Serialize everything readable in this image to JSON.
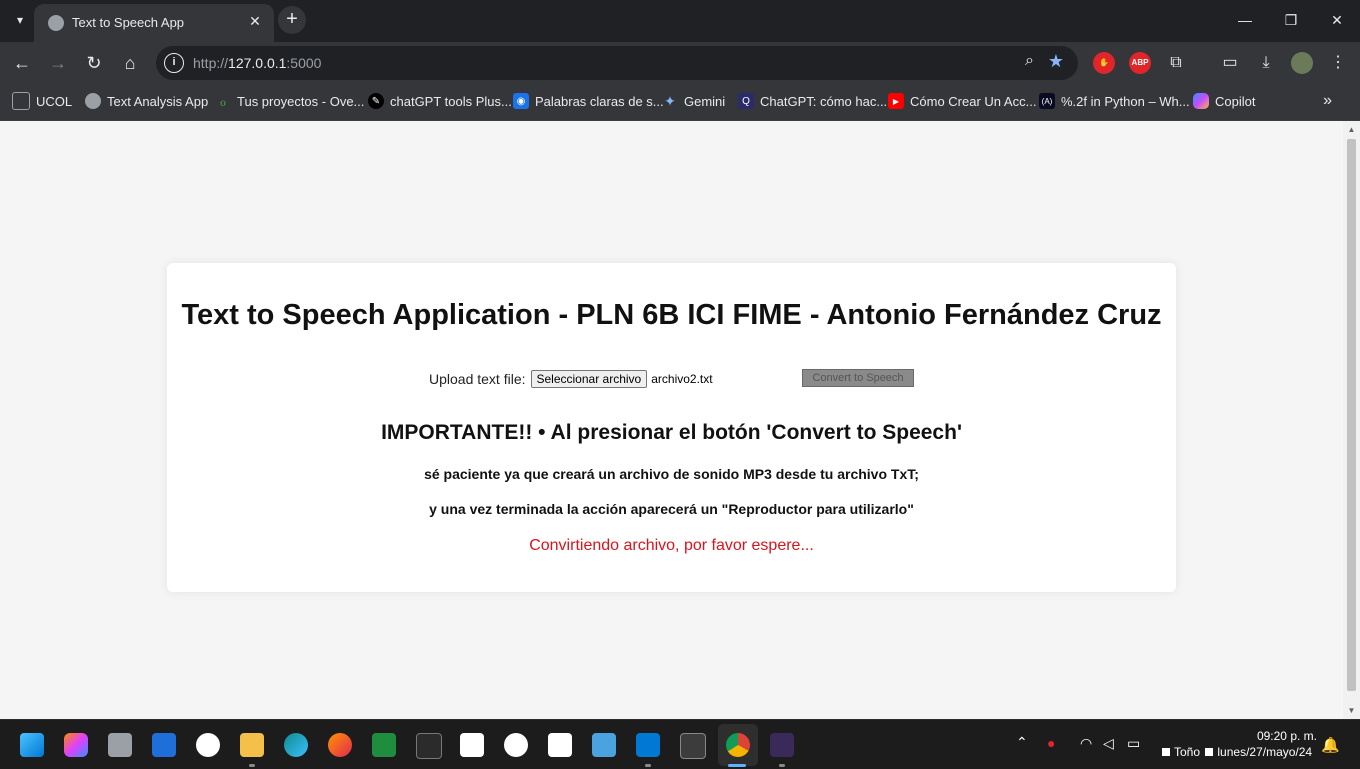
{
  "browser": {
    "tab_title": "Text to Speech App",
    "tab_close": "✕",
    "new_tab": "+",
    "url_scheme": "http://",
    "url_host": "127.0.0.1",
    "url_port": ":5000",
    "bookmarks": [
      {
        "label": "UCOL",
        "icon": "folder-icon",
        "color": "#5f6368"
      },
      {
        "label": "Text Analysis App",
        "icon": "globe-icon",
        "color": "#5f6368"
      },
      {
        "label": "Tus proyectos - Ove...",
        "icon": "overleaf-icon",
        "color": "#47a141"
      },
      {
        "label": "chatGPT tools Plus...",
        "icon": "quill-icon",
        "color": "#000000"
      },
      {
        "label": "Palabras claras de s...",
        "icon": "chat-icon",
        "color": "#1a73e8"
      },
      {
        "label": "Gemini",
        "icon": "gemini-icon",
        "color": "#4285f4"
      },
      {
        "label": "ChatGPT: cómo hac...",
        "icon": "chatgpt-icon",
        "color": "#2b2b6b"
      },
      {
        "label": "Cómo Crear Un Acc...",
        "icon": "youtube-icon",
        "color": "#ff0000"
      },
      {
        "label": "%.2f in Python – Wh...",
        "icon": "freecodecamp-icon",
        "color": "#0a0a23"
      },
      {
        "label": "Copilot",
        "icon": "copilot-icon",
        "color": "#7c4dff"
      }
    ],
    "extensions": {
      "abp": "ABP"
    }
  },
  "page": {
    "heading": "Text to Speech Application - PLN 6B ICI FIME - Antonio Fernández Cruz",
    "upload_label": "Upload text file:",
    "file_button": "Seleccionar archivo",
    "file_name": "archivo2.txt",
    "convert_button": "Convert to Speech",
    "important": "IMPORTANTE!! • Al presionar el botón 'Convert to Speech'",
    "note1": "sé paciente ya que creará un archivo de sonido MP3 desde tu archivo TxT;",
    "note2": "y una vez terminada la acción aparecerá un \"Reproductor para utilizarlo\"",
    "status": "Convirtiendo archivo, por favor espere...",
    "status_color": "#d9141c"
  },
  "taskbar": {
    "time": "09:20 p. m.",
    "user": "Toño",
    "date": "lunes/27/mayo/24"
  }
}
